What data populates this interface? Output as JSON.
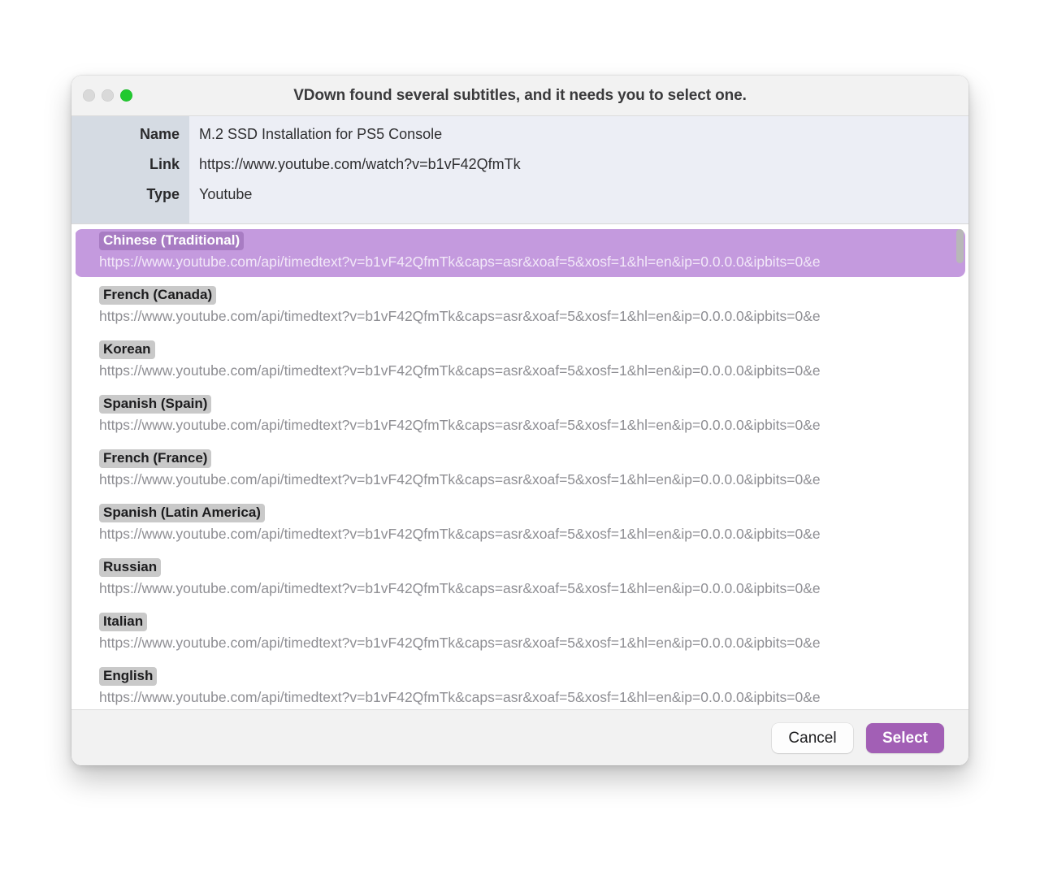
{
  "window": {
    "title": "VDown found several subtitles, and it needs you to select one.",
    "traffic_lights": {
      "close": "close-button",
      "minimize": "minimize-button",
      "maximize": "maximize-button"
    }
  },
  "info": {
    "rows": [
      {
        "label": "Name",
        "value": "M.2 SSD Installation for PS5 Console"
      },
      {
        "label": "Link",
        "value": "https://www.youtube.com/watch?v=b1vF42QfmTk"
      },
      {
        "label": "Type",
        "value": "Youtube"
      }
    ]
  },
  "subtitles": {
    "items": [
      {
        "language": "Chinese (Traditional)",
        "url": "https://www.youtube.com/api/timedtext?v=b1vF42QfmTk&caps=asr&xoaf=5&xosf=1&hl=en&ip=0.0.0.0&ipbits=0&e",
        "selected": true
      },
      {
        "language": "French (Canada)",
        "url": "https://www.youtube.com/api/timedtext?v=b1vF42QfmTk&caps=asr&xoaf=5&xosf=1&hl=en&ip=0.0.0.0&ipbits=0&e",
        "selected": false
      },
      {
        "language": "Korean",
        "url": "https://www.youtube.com/api/timedtext?v=b1vF42QfmTk&caps=asr&xoaf=5&xosf=1&hl=en&ip=0.0.0.0&ipbits=0&e",
        "selected": false
      },
      {
        "language": "Spanish (Spain)",
        "url": "https://www.youtube.com/api/timedtext?v=b1vF42QfmTk&caps=asr&xoaf=5&xosf=1&hl=en&ip=0.0.0.0&ipbits=0&e",
        "selected": false
      },
      {
        "language": "French (France)",
        "url": "https://www.youtube.com/api/timedtext?v=b1vF42QfmTk&caps=asr&xoaf=5&xosf=1&hl=en&ip=0.0.0.0&ipbits=0&e",
        "selected": false
      },
      {
        "language": "Spanish (Latin America)",
        "url": "https://www.youtube.com/api/timedtext?v=b1vF42QfmTk&caps=asr&xoaf=5&xosf=1&hl=en&ip=0.0.0.0&ipbits=0&e",
        "selected": false
      },
      {
        "language": "Russian",
        "url": "https://www.youtube.com/api/timedtext?v=b1vF42QfmTk&caps=asr&xoaf=5&xosf=1&hl=en&ip=0.0.0.0&ipbits=0&e",
        "selected": false
      },
      {
        "language": "Italian",
        "url": "https://www.youtube.com/api/timedtext?v=b1vF42QfmTk&caps=asr&xoaf=5&xosf=1&hl=en&ip=0.0.0.0&ipbits=0&e",
        "selected": false
      },
      {
        "language": "English",
        "url": "https://www.youtube.com/api/timedtext?v=b1vF42QfmTk&caps=asr&xoaf=5&xosf=1&hl=en&ip=0.0.0.0&ipbits=0&e",
        "selected": false
      }
    ]
  },
  "footer": {
    "cancel_label": "Cancel",
    "select_label": "Select"
  },
  "colors": {
    "accent": "#a25fb5",
    "selected_row": "#c49ade",
    "selected_badge": "#a87cc3",
    "badge": "#c9c9c9",
    "info_label_col": "#d5dbe3",
    "info_panel": "#eceef5",
    "titlebar": "#f2f2f2",
    "maximize_green": "#21c92f"
  }
}
